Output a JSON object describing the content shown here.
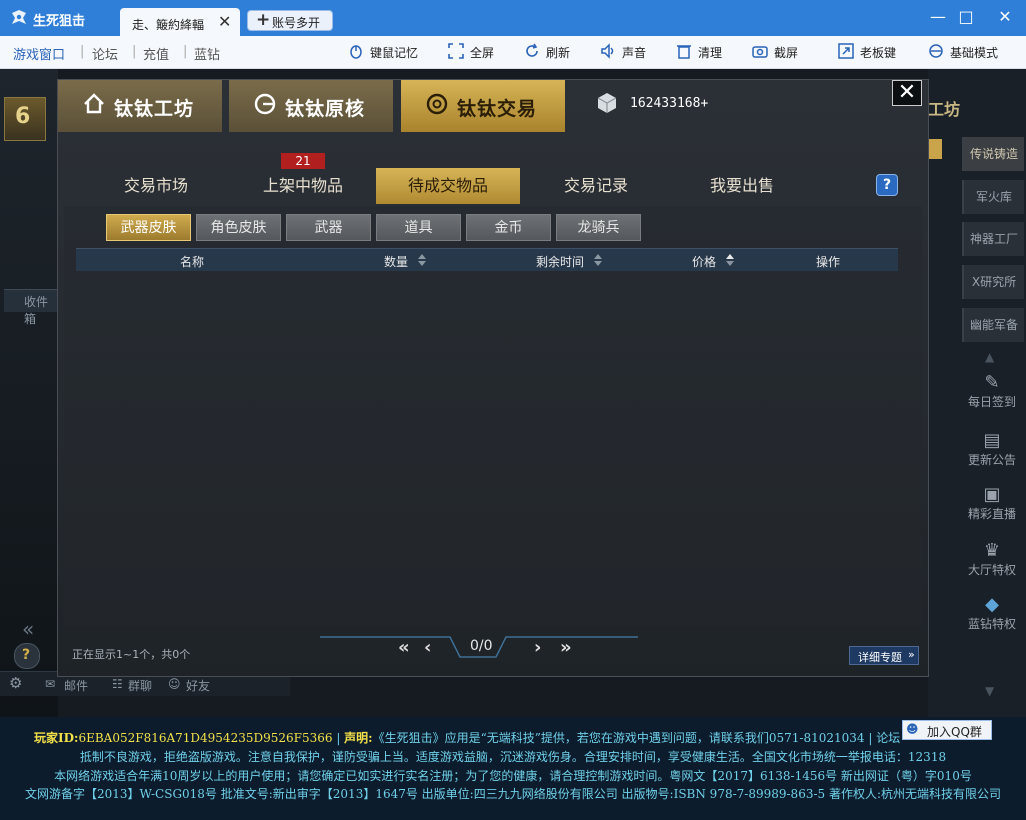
{
  "app": {
    "title": "生死狙击"
  },
  "browser_tab": {
    "label": "走、簸約絳輻",
    "close": "✕"
  },
  "multi_open": {
    "label": "账号多开",
    "plus": "+"
  },
  "window_controls": {
    "min": "—",
    "max": "□",
    "close": "✕"
  },
  "toolbar": {
    "nav": [
      "游戏窗口",
      "论坛",
      "充值",
      "蓝钻"
    ],
    "tools": [
      "键鼠记忆",
      "全屏",
      "刷新",
      "声音",
      "清理",
      "截屏",
      "老板键",
      "基础模式"
    ]
  },
  "left_side": {
    "badge_text": "6",
    "label": "收件箱",
    "help": "?",
    "bottom": [
      "邮件",
      "群聊",
      "好友"
    ],
    "collapse": "«"
  },
  "right_side": {
    "header": "工坊",
    "items": [
      "传说铸造",
      "军火库",
      "神器工厂",
      "X研究所",
      "幽能军备"
    ],
    "lower": [
      "每日签到",
      "更新公告",
      "精彩直播",
      "大厅特权",
      "蓝钻特权"
    ]
  },
  "panel": {
    "top_tabs": [
      "钛钛工坊",
      "钛钛原核",
      "钛钛交易"
    ],
    "balance": "162433168+",
    "close": "✕",
    "sub_tabs": [
      "交易市场",
      "上架中物品",
      "待成交物品",
      "交易记录",
      "我要出售"
    ],
    "badge": "21",
    "help": "?",
    "categories": [
      "武器皮肤",
      "角色皮肤",
      "武器",
      "道具",
      "金币",
      "龙骑兵"
    ],
    "columns": [
      "名称",
      "数量",
      "剩余时间",
      "价格",
      "操作"
    ],
    "status": "正在显示1~1个，共0个",
    "pager": {
      "first": "«",
      "prev": "‹",
      "page": "0/0",
      "next": "›",
      "last": "»"
    },
    "detail": "详细专题"
  },
  "footer": {
    "player_label": "玩家ID:",
    "player_id": "6EBA052F816A71D4954235D9526F5366",
    "statement_label": "声明:",
    "statement": "《生死狙击》应用是“无端科技”提供，若您在游戏中遇到问题，请联系我们0571-81021034 | 论坛",
    "qq": "加入QQ群",
    "line2": "抵制不良游戏，拒绝盗版游戏。注意自我保护，谨防受骗上当。适度游戏益脑，沉迷游戏伤身。合理安排时间，享受健康生活。全国文化市场统一举报电话：12318",
    "line3": "本网络游戏适合年满10周岁以上的用户使用；请您确定已如实进行实名注册；为了您的健康，请合理控制游戏时间。粤网文【2017】6138-1456号  新出网证（粤）字010号",
    "line4": "文网游备字【2013】W-CSG018号  批准文号:新出审字【2013】1647号  出版单位:四三九九网络股份有限公司  出版物号:ISBN 978-7-89989-863-5 著作权人:杭州无端科技有限公司"
  },
  "colors": {
    "title_bar": "#2f7fd8",
    "gold_tab": "#c9a44a",
    "footer_text": "#6fd0ea"
  }
}
